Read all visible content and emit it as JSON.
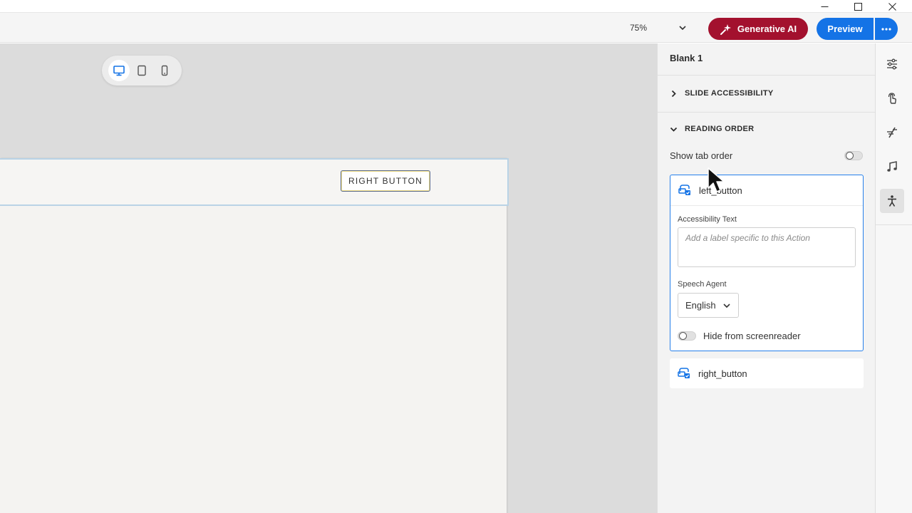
{
  "window": {
    "controls": [
      "minimize-icon",
      "maximize-icon",
      "close-icon"
    ]
  },
  "toolbar": {
    "zoom_value": "75%",
    "genai_label": "Generative AI",
    "preview_label": "Preview",
    "more_icon": "ellipsis-icon",
    "colors": {
      "genai": "#a3112e",
      "preview": "#1473e6"
    }
  },
  "canvas": {
    "devices": [
      {
        "name": "desktop",
        "icon": "desktop-icon",
        "active": true
      },
      {
        "name": "tablet",
        "icon": "tablet-icon",
        "active": false
      },
      {
        "name": "mobile",
        "icon": "mobile-icon",
        "active": false
      }
    ],
    "button_label": "RIGHT BUTTON"
  },
  "panel": {
    "title": "Blank 1",
    "slide_accessibility": "SLIDE ACCESSIBILITY",
    "reading_order": "READING ORDER",
    "show_tab_order": "Show tab order",
    "show_tab_order_on": false,
    "item1": {
      "name": "left_button",
      "accessibility_text_label": "Accessibility Text",
      "accessibility_text_placeholder": "Add a label specific to this Action",
      "accessibility_text_value": "",
      "speech_agent_label": "Speech Agent",
      "speech_agent_value": "English",
      "hide_label": "Hide from screenreader",
      "hide_on": false
    },
    "item2": {
      "name": "right_button"
    }
  },
  "rail": {
    "icons": [
      "properties-icon",
      "interaction-icon",
      "effects-icon",
      "audio-icon",
      "accessibility-icon"
    ],
    "active": "accessibility-icon"
  }
}
